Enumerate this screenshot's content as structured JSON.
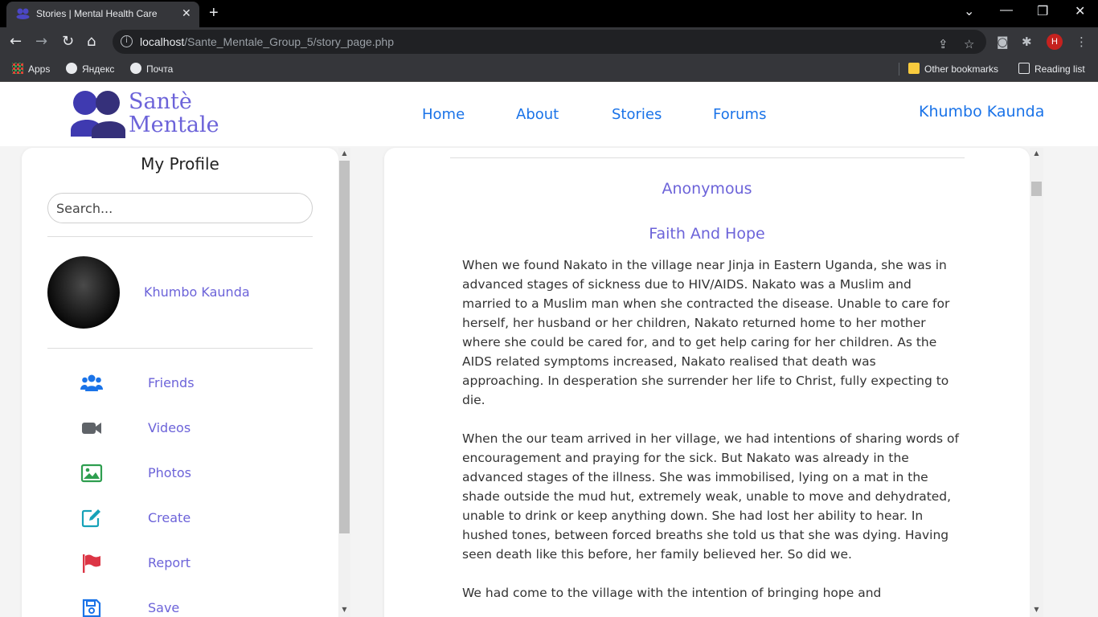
{
  "browser": {
    "tab_title": "Stories | Mental Health Care",
    "url_host": "localhost",
    "url_path": "/Sante_Mentale_Group_5/story_page.php",
    "profile_initial": "H",
    "bookmarks": {
      "apps": "Apps",
      "yandex": "Яндекс",
      "pochta": "Почта",
      "other": "Other bookmarks",
      "reading_list": "Reading list"
    }
  },
  "header": {
    "logo_line1": "Santè",
    "logo_line2": "Mentale",
    "nav": [
      "Home",
      "About",
      "Stories",
      "Forums"
    ],
    "user_name": "Khumbo Kaunda"
  },
  "sidebar": {
    "title": "My Profile",
    "search_placeholder": "Search...",
    "profile_name": "Khumbo Kaunda",
    "menu": [
      {
        "label": "Friends",
        "icon": "users-icon"
      },
      {
        "label": "Videos",
        "icon": "video-icon"
      },
      {
        "label": "Photos",
        "icon": "image-icon"
      },
      {
        "label": "Create",
        "icon": "edit-icon"
      },
      {
        "label": "Report",
        "icon": "flag-icon"
      },
      {
        "label": "Save",
        "icon": "save-icon"
      }
    ]
  },
  "story": {
    "author": "Anonymous",
    "title": "Faith And Hope",
    "paragraphs": [
      "When we found Nakato in the village near Jinja in Eastern Uganda, she was in advanced stages of sickness due to HIV/AIDS. Nakato was a Muslim and married to a Muslim man when she contracted the disease. Unable to care for herself, her husband or her children, Nakato returned home to her mother where she could be cared for, and to get help caring for her children. As the AIDS related symptoms increased, Nakato realised that death was approaching. In desperation she surrender her life to Christ, fully expecting to die.",
      "When the our team arrived in her village, we had intentions of sharing words of encouragement and praying for the sick. But Nakato was already in the advanced stages of the illness. She was immobilised, lying on a mat in the shade outside the mud hut, extremely weak, unable to move and dehydrated, unable to drink or keep anything down. She had lost her ability to hear. In hushed tones, between forced breaths she told us that she was dying. Having seen death like this before, her family believed her. So did we.",
      "We had come to the village with the intention of bringing hope and"
    ]
  },
  "colors": {
    "accent": "#6c63d9",
    "link": "#1a73e8",
    "friends_icon": "#1a73e8",
    "videos_icon": "#5f6368",
    "photos_icon": "#2e9e4f",
    "create_icon": "#17a2b8",
    "report_icon": "#dc3545",
    "save_icon": "#1a73e8"
  }
}
